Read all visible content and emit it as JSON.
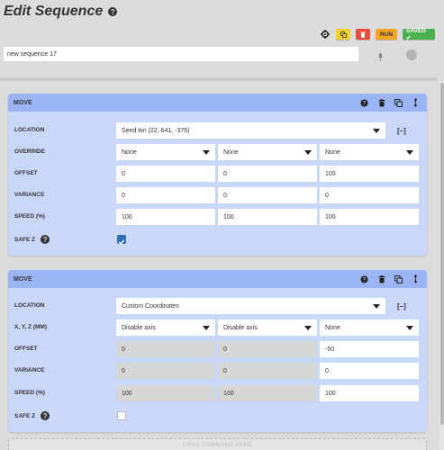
{
  "page": {
    "title": "Edit Sequence"
  },
  "toolbar": {
    "run_label": "RUN",
    "saved_label": "SAVED ✔"
  },
  "sequence": {
    "name": "new sequence 17"
  },
  "steps": [
    {
      "title": "MOVE",
      "location_label": "LOCATION",
      "location_value": "Seed bin (22, 641, -376)",
      "row2_label": "OVERRIDE",
      "row2_values": [
        "None",
        "None",
        "None"
      ],
      "offset_label": "OFFSET",
      "offset": [
        "0",
        "0",
        "100"
      ],
      "variance_label": "VARIANCE",
      "variance": [
        "0",
        "0",
        "0"
      ],
      "speed_label": "SPEED (%)",
      "speed": [
        "100",
        "100",
        "100"
      ],
      "safez_label": "SAFE Z",
      "safe_z": true
    },
    {
      "title": "MOVE",
      "location_label": "LOCATION",
      "location_value": "Custom Coordinates",
      "row2_label": "X, Y, Z (MM)",
      "row2_values": [
        "Disable axis",
        "Disable axis",
        "None"
      ],
      "offset_label": "OFFSET",
      "offset": [
        "0",
        "0",
        "-50"
      ],
      "variance_label": "VARIANCE",
      "variance": [
        "0",
        "0",
        "0"
      ],
      "speed_label": "SPEED (%)",
      "speed": [
        "100",
        "100",
        "100"
      ],
      "safez_label": "SAFE Z",
      "safe_z": false
    }
  ],
  "dropzone": {
    "label": "DRAG COMMAND HERE"
  },
  "colors": {
    "header": "#9bb4f4",
    "body": "#c9d7fb",
    "checkbox": "#2f6eb5",
    "saved": "#4caf50",
    "run": "#f5a623",
    "delete": "#e74c3c",
    "copy": "#f3d22a"
  }
}
